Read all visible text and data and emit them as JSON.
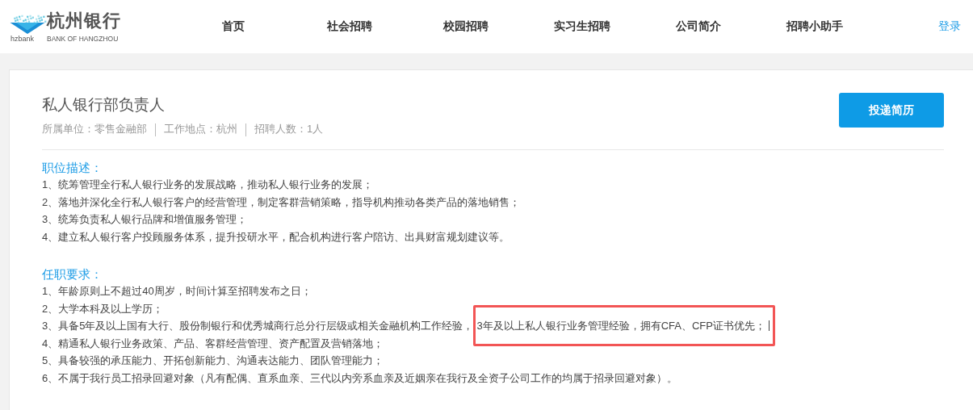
{
  "header": {
    "logo": {
      "name": "杭州银行",
      "tag": "hzbank",
      "subtitle": "BANK OF HANGZHOU"
    },
    "nav": [
      {
        "label": "首页"
      },
      {
        "label": "社会招聘"
      },
      {
        "label": "校园招聘"
      },
      {
        "label": "实习生招聘"
      },
      {
        "label": "公司简介"
      },
      {
        "label": "招聘小助手"
      }
    ],
    "login": "登录"
  },
  "job": {
    "title": "私人银行部负责人",
    "meta": [
      "所属单位：零售金融部",
      "工作地点：杭州",
      "招聘人数：1人"
    ],
    "apply_button": "投递简历",
    "sections": [
      {
        "heading": "职位描述：",
        "lines": [
          {
            "text": "1、统筹管理全行私人银行业务的发展战略，推动私人银行业务的发展；"
          },
          {
            "text": "2、落地并深化全行私人银行客户的经营管理，制定客群营销策略，指导机构推动各类产品的落地销售；"
          },
          {
            "text": "3、统筹负责私人银行品牌和增值服务管理；"
          },
          {
            "text": "4、建立私人银行客户投顾服务体系，提升投研水平，配合机构进行客户陪访、出具财富规划建议等。"
          }
        ]
      },
      {
        "heading": "任职要求：",
        "lines": [
          {
            "text": "1、年龄原则上不超过40周岁，时间计算至招聘发布之日；"
          },
          {
            "text": "2、大学本科及以上学历；"
          },
          {
            "text": "3、具备5年及以上国有大行、股份制银行和优秀城商行总分行层级或相关金融机构工作经验，",
            "highlighted": "3年及以上私人银行业务管理经验，拥有CFA、CFP证书优先；",
            "cursor": true
          },
          {
            "text": "4、精通私人银行业务政策、产品、客群经营管理、资产配置及营销落地；"
          },
          {
            "text": "5、具备较强的承压能力、开拓创新能力、沟通表达能力、团队管理能力；"
          },
          {
            "text": "6、不属于我行员工招录回避对象（凡有配偶、直系血亲、三代以内旁系血亲及近姻亲在我行及全资子公司工作的均属于招录回避对象）。"
          }
        ]
      }
    ]
  }
}
